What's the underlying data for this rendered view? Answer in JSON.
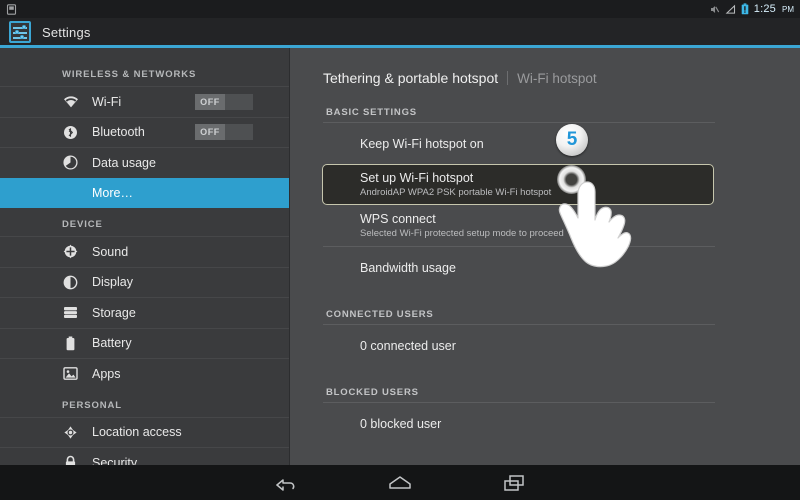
{
  "statusbar": {
    "time": "1:25",
    "ampm": "PM",
    "icons": [
      "screenshot-icon",
      "mute-icon",
      "signal-icon",
      "battery-icon"
    ]
  },
  "actionbar": {
    "app_icon": "settings-sliders-icon",
    "title": "Settings",
    "accent_color": "#3ba6d4"
  },
  "sidebar": {
    "sections": [
      {
        "header": "WIRELESS & NETWORKS",
        "items": [
          {
            "label": "Wi-Fi",
            "icon": "wifi-icon",
            "toggle": "OFF"
          },
          {
            "label": "Bluetooth",
            "icon": "bluetooth-icon",
            "toggle": "OFF"
          },
          {
            "label": "Data usage",
            "icon": "data-usage-icon"
          },
          {
            "label": "More…",
            "icon": "",
            "selected": true
          }
        ]
      },
      {
        "header": "DEVICE",
        "items": [
          {
            "label": "Sound",
            "icon": "sound-icon"
          },
          {
            "label": "Display",
            "icon": "display-icon"
          },
          {
            "label": "Storage",
            "icon": "storage-icon"
          },
          {
            "label": "Battery",
            "icon": "battery-icon"
          },
          {
            "label": "Apps",
            "icon": "apps-icon"
          }
        ]
      },
      {
        "header": "PERSONAL",
        "items": [
          {
            "label": "Location access",
            "icon": "location-icon"
          },
          {
            "label": "Security",
            "icon": "lock-icon"
          }
        ]
      }
    ]
  },
  "pane": {
    "title": "Tethering & portable hotspot",
    "subtitle": "Wi-Fi hotspot",
    "groups": [
      {
        "header": "BASIC SETTINGS",
        "rows": [
          {
            "title": "Keep Wi-Fi hotspot on",
            "subtitle": ""
          },
          {
            "title": "Set up Wi-Fi hotspot",
            "subtitle": "AndroidAP WPA2 PSK portable Wi-Fi hotspot",
            "focused": true
          },
          {
            "title": "WPS connect",
            "subtitle": "Selected Wi-Fi protected setup mode to proceed"
          },
          {
            "title": "Bandwidth usage",
            "subtitle": ""
          }
        ]
      },
      {
        "header": "CONNECTED USERS",
        "rows": [
          {
            "title": "0 connected user",
            "subtitle": ""
          }
        ]
      },
      {
        "header": "BLOCKED USERS",
        "rows": [
          {
            "title": "0 blocked user",
            "subtitle": ""
          }
        ]
      }
    ]
  },
  "step_badge": {
    "number": "5",
    "color": "#2196d8"
  },
  "navbar": {
    "buttons": [
      {
        "name": "back-icon"
      },
      {
        "name": "home-icon"
      },
      {
        "name": "recents-icon"
      }
    ]
  }
}
